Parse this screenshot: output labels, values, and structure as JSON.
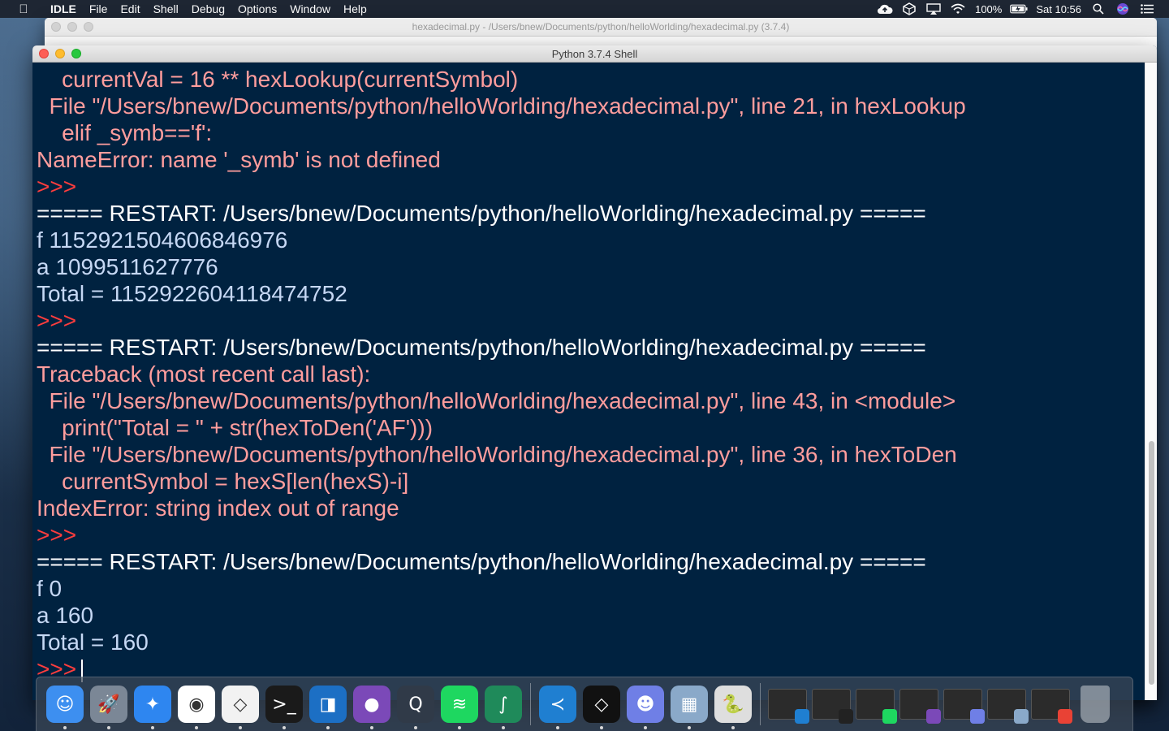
{
  "menubar": {
    "app_name": "IDLE",
    "items": [
      "File",
      "Edit",
      "Shell",
      "Debug",
      "Options",
      "Window",
      "Help"
    ],
    "battery": "100%",
    "clock": "Sat 10:56"
  },
  "editor_window": {
    "title": "hexadecimal.py - /Users/bnew/Documents/python/helloWorlding/hexadecimal.py (3.7.4)"
  },
  "shell_window": {
    "title": "Python 3.7.4 Shell",
    "lines": [
      {
        "kind": "error",
        "text": "    currentVal = 16 ** hexLookup(currentSymbol)"
      },
      {
        "kind": "error",
        "text": "  File \"/Users/bnew/Documents/python/helloWorlding/hexadecimal.py\", line 21, in hexLookup"
      },
      {
        "kind": "error",
        "text": "    elif _symb=='f':"
      },
      {
        "kind": "error",
        "text": "NameError: name '_symb' is not defined"
      },
      {
        "kind": "prompt",
        "text": ">>>"
      },
      {
        "kind": "restart",
        "text": "===== RESTART: /Users/bnew/Documents/python/helloWorlding/hexadecimal.py ====="
      },
      {
        "kind": "stdout",
        "text": "f 1152921504606846976"
      },
      {
        "kind": "stdout",
        "text": "a 1099511627776"
      },
      {
        "kind": "stdout",
        "text": "Total = 1152922604118474752"
      },
      {
        "kind": "prompt",
        "text": ">>>"
      },
      {
        "kind": "restart",
        "text": "===== RESTART: /Users/bnew/Documents/python/helloWorlding/hexadecimal.py ====="
      },
      {
        "kind": "error",
        "text": "Traceback (most recent call last):"
      },
      {
        "kind": "error",
        "text": "  File \"/Users/bnew/Documents/python/helloWorlding/hexadecimal.py\", line 43, in <module>"
      },
      {
        "kind": "error",
        "text": "    print(\"Total = \" + str(hexToDen('AF')))"
      },
      {
        "kind": "error",
        "text": "  File \"/Users/bnew/Documents/python/helloWorlding/hexadecimal.py\", line 36, in hexToDen"
      },
      {
        "kind": "error",
        "text": "    currentSymbol = hexS[len(hexS)-i]"
      },
      {
        "kind": "error",
        "text": "IndexError: string index out of range"
      },
      {
        "kind": "prompt",
        "text": ">>>"
      },
      {
        "kind": "restart",
        "text": "===== RESTART: /Users/bnew/Documents/python/helloWorlding/hexadecimal.py ====="
      },
      {
        "kind": "stdout",
        "text": "f 0"
      },
      {
        "kind": "stdout",
        "text": "a 160"
      },
      {
        "kind": "stdout",
        "text": "Total = 160"
      },
      {
        "kind": "prompt",
        "text": ">>>",
        "cursor": true
      }
    ]
  },
  "dock": {
    "apps": [
      {
        "name": "finder-icon",
        "color": "#3d8ff0",
        "glyph": "☺"
      },
      {
        "name": "launchpad-icon",
        "color": "#7b8796",
        "glyph": "🚀"
      },
      {
        "name": "safari-icon",
        "color": "#2e86f0",
        "glyph": "✦"
      },
      {
        "name": "chrome-icon",
        "color": "#ffffff",
        "glyph": "◉"
      },
      {
        "name": "unity-icon",
        "color": "#f2f2f2",
        "glyph": "◇"
      },
      {
        "name": "terminal-icon",
        "color": "#1a1a1a",
        "glyph": ">_"
      },
      {
        "name": "sourcetree-icon",
        "color": "#1c6fc4",
        "glyph": "◨"
      },
      {
        "name": "github-desktop-icon",
        "color": "#7b49b8",
        "glyph": "●"
      },
      {
        "name": "quicktime-icon",
        "color": "#303a48",
        "glyph": "Q"
      },
      {
        "name": "spotify-icon",
        "color": "#1ed760",
        "glyph": "≋"
      },
      {
        "name": "grapher-icon",
        "color": "#1f8a5a",
        "glyph": "∫"
      }
    ],
    "apps2": [
      {
        "name": "vscode-icon",
        "color": "#1f7fd1",
        "glyph": "≺"
      },
      {
        "name": "unity-hub-icon",
        "color": "#111111",
        "glyph": "◇"
      },
      {
        "name": "discord-icon",
        "color": "#6f7fe6",
        "glyph": "☻"
      },
      {
        "name": "preview-icon",
        "color": "#8aa9c9",
        "glyph": "▦"
      },
      {
        "name": "python-launcher-icon",
        "color": "#dedede",
        "glyph": "🐍"
      }
    ],
    "windows": [
      {
        "name": "minimized-vscode-window",
        "badge": "#1f7fd1"
      },
      {
        "name": "minimized-unity-window",
        "badge": "#222222"
      },
      {
        "name": "minimized-spotify-window",
        "badge": "#1ed760"
      },
      {
        "name": "minimized-github-window",
        "badge": "#7b49b8"
      },
      {
        "name": "minimized-discord-window",
        "badge": "#6f7fe6"
      },
      {
        "name": "minimized-preview-window",
        "badge": "#8aa9c9"
      },
      {
        "name": "minimized-chrome-window",
        "badge": "#e94235"
      }
    ],
    "trash": {
      "name": "trash-icon"
    }
  }
}
